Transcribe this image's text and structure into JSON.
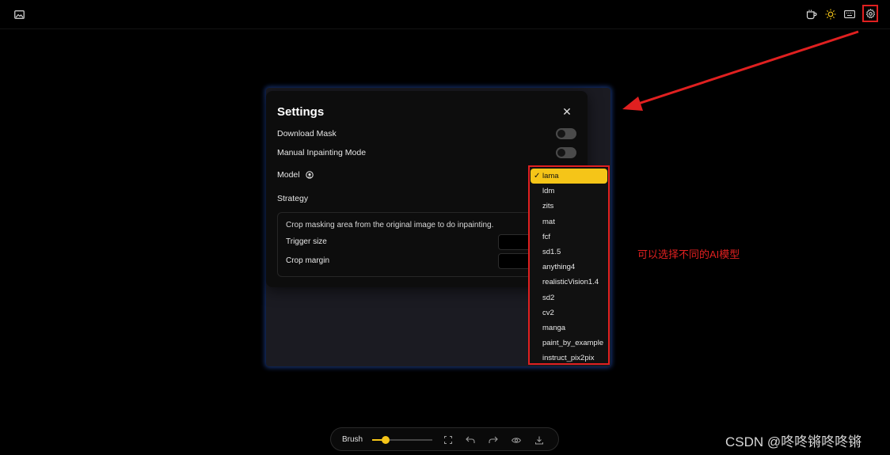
{
  "settings": {
    "title": "Settings",
    "download_mask_label": "Download Mask",
    "download_mask_on": false,
    "manual_inpainting_label": "Manual Inpainting Mode",
    "manual_inpainting_on": false,
    "model_label": "Model",
    "strategy_label": "Strategy",
    "strategy_description": "Crop masking area from the original image to do inpainting.",
    "trigger_size_label": "Trigger size",
    "crop_margin_label": "Crop margin"
  },
  "model_dropdown": {
    "selected": "lama",
    "options": [
      "lama",
      "ldm",
      "zits",
      "mat",
      "fcf",
      "sd1.5",
      "anything4",
      "realisticVision1.4",
      "sd2",
      "cv2",
      "manga",
      "paint_by_example",
      "instruct_pix2pix"
    ]
  },
  "annotation": {
    "text": "可以选择不同的AI模型"
  },
  "toolbar": {
    "brush_label": "Brush",
    "brush_level": 0.22
  },
  "watermark": {
    "text": "CSDN @咚咚锵咚咚锵"
  },
  "icons": {
    "top_left": "image-icon",
    "top_right": [
      "coffee-icon",
      "sun-icon",
      "keyboard-icon",
      "gear-icon"
    ],
    "toolbar": [
      "fullscreen-icon",
      "undo-icon",
      "redo-icon",
      "eye-icon",
      "download-icon"
    ]
  },
  "colors": {
    "accent": "#f5c518",
    "annotation_red": "#e02020",
    "background": "#000000"
  }
}
